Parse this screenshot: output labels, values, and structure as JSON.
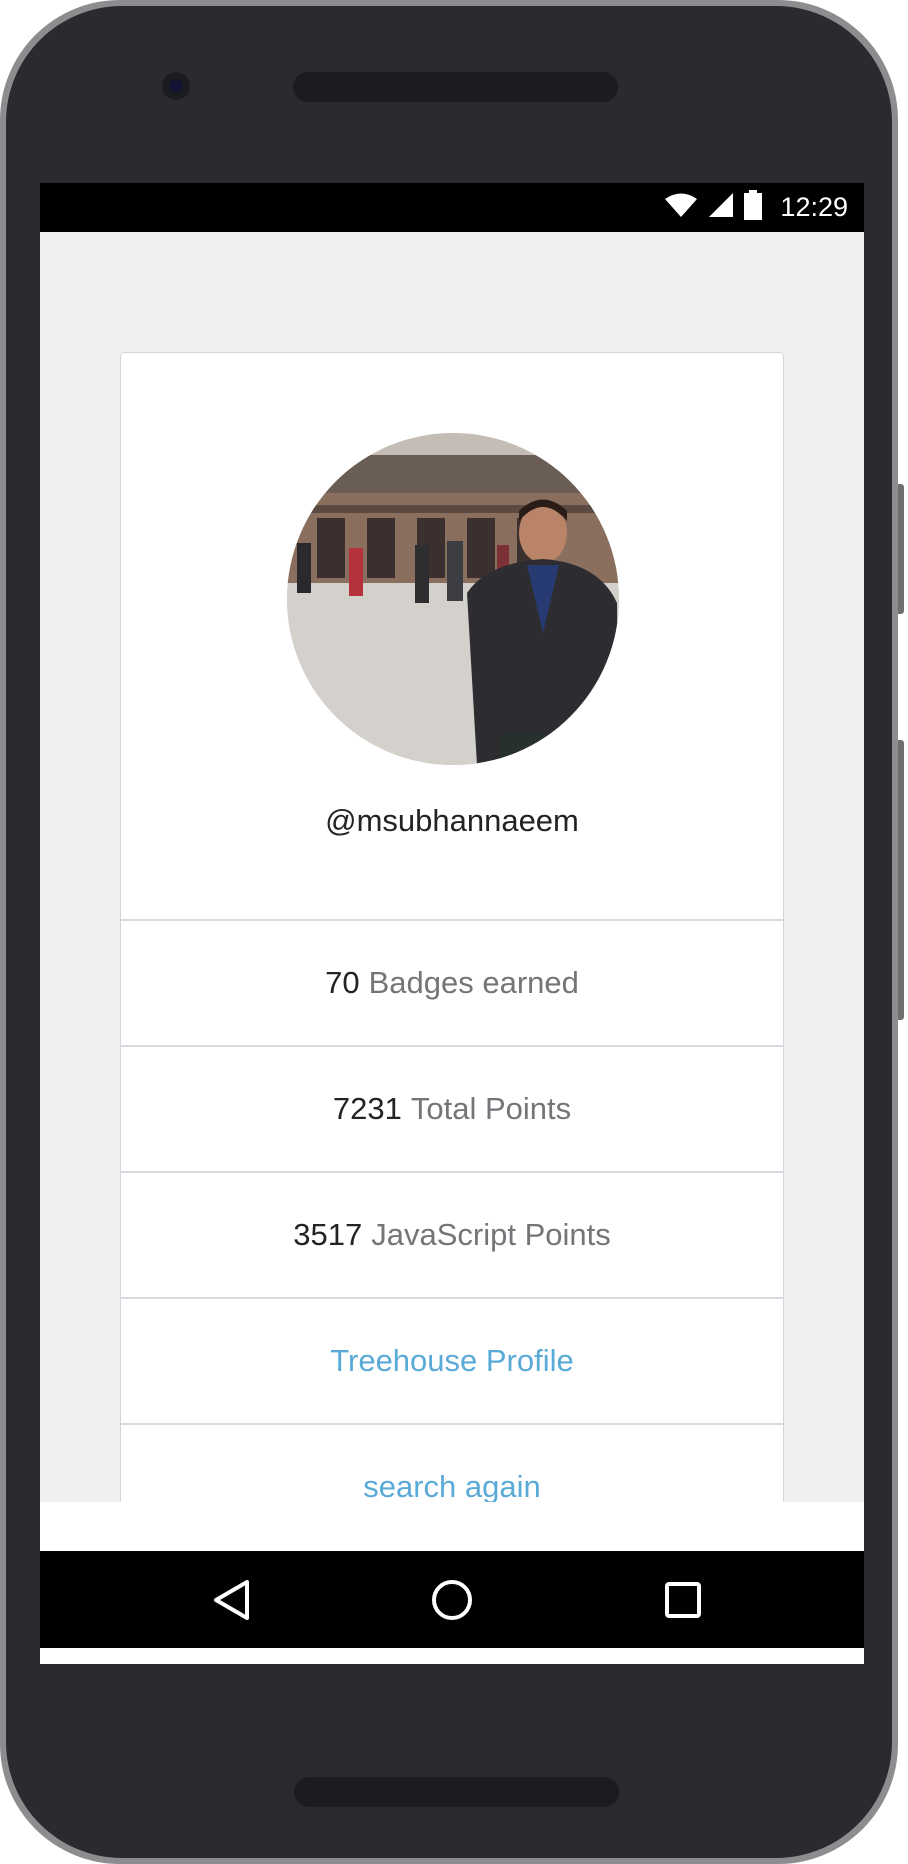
{
  "status_bar": {
    "time": "12:29",
    "icons": [
      "wifi-icon",
      "cell-signal-icon",
      "battery-icon"
    ]
  },
  "profile": {
    "avatar": "profile-photo",
    "username": "@msubhannaeem"
  },
  "stats": [
    {
      "value": "70",
      "label": "Badges earned"
    },
    {
      "value": "7231",
      "label": "Total Points"
    },
    {
      "value": "3517",
      "label": "JavaScript Points"
    }
  ],
  "links": {
    "profile": "Treehouse Profile",
    "search_again": "search again"
  },
  "nav_bar": {
    "icons": [
      "back-icon",
      "home-icon",
      "recents-icon"
    ]
  },
  "colors": {
    "background": "#eeeff0",
    "card": "#ffffff",
    "link": "#5aaad8",
    "muted_text": "#737579",
    "dark_text": "#222325",
    "divider": "#d7dae0"
  }
}
